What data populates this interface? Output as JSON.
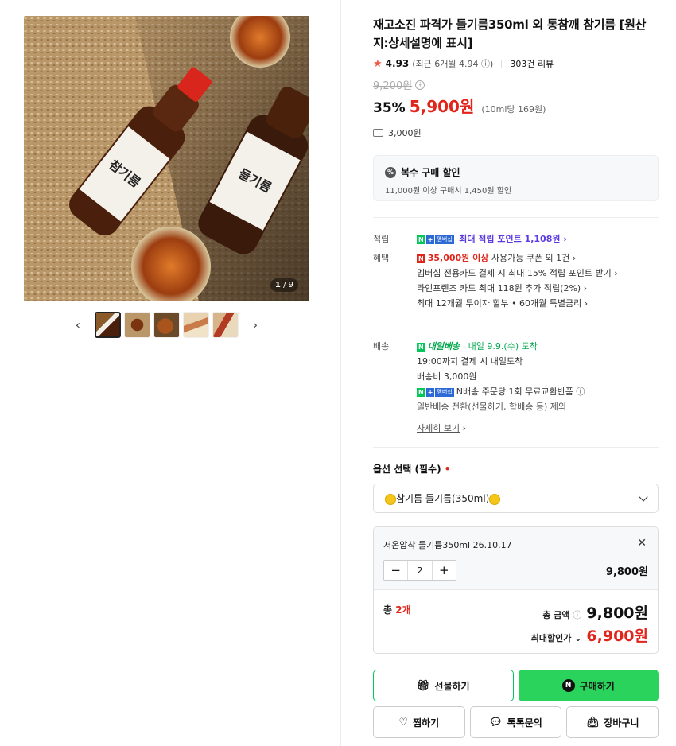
{
  "gallery": {
    "counter_current": "1",
    "counter_total": "/ 9",
    "thumb_count": 5,
    "prev_glyph": "‹",
    "next_glyph": "›",
    "label_left": "참기름",
    "label_right": "들기름"
  },
  "product": {
    "title": "재고소진 파격가 들기름350ml 외 통참깨 참기름 [원산지:상세설명에 표시]",
    "rating": "4.93",
    "rating_recent": "(최근 6개월 4.94",
    "rating_close": ")",
    "review_count": "303건 리뷰",
    "original_price": "9,200원",
    "discount_rate": "35%",
    "sale_price": "5,900원",
    "unit_price": "(10ml당 169원)",
    "shipping_fee": "3,000원"
  },
  "multi_discount": {
    "title": "복수 구매 할인",
    "desc": "11,000원 이상 구매시 1,450원 할인"
  },
  "benefits": {
    "reward_label": "적립",
    "reward_text": "최대 적립 포인트 1,108원",
    "benefit_label": "혜택",
    "coupon_bold": "35,000원 이상",
    "coupon_rest": "사용가능 쿠폰 외 1건",
    "card1": "멤버십 전용카드 결제 시 최대 15% 적립 포인트 받기",
    "card2": "라인프렌즈 카드 최대 118원 추가 적립(2%)",
    "card3": "최대 12개월 무이자 할부 • 60개월 특별금리",
    "membership_badge": "멤버십",
    "n_badge": "N"
  },
  "delivery": {
    "label": "배송",
    "type": "내일배송",
    "arrival": "· 내일 9.9.(수) 도착",
    "cutoff": "19:00까지 결제 시 내일도착",
    "fee": "배송비 3,000원",
    "exchange": "N배송 주문당 1회 무료교환반품",
    "exception": "일반배송 전환(선물하기, 합배송 등) 제외",
    "detail_link": "자세히 보기"
  },
  "options": {
    "label": "옵션 선택 (필수)",
    "required_mark": "•",
    "selected": "참기름 들기름(350ml)"
  },
  "selection": {
    "name": "저온압착 들기름350ml 26.10.17",
    "quantity": "2",
    "price": "9,800원",
    "total_label": "총",
    "total_count": "2개",
    "total_amount_label": "총 금액",
    "total_amount": "9,800원",
    "max_label": "최대할인가",
    "max_amount": "6,900원"
  },
  "buttons": {
    "gift": "선물하기",
    "buy": "구매하기",
    "wish": "찜하기",
    "talk": "톡톡문의",
    "cart": "장바구니"
  },
  "colors": {
    "accent_red": "#e1251b",
    "naver_green": "#03c75a",
    "buy_button": "#2ad45c",
    "points_purple": "#5b3be0"
  }
}
